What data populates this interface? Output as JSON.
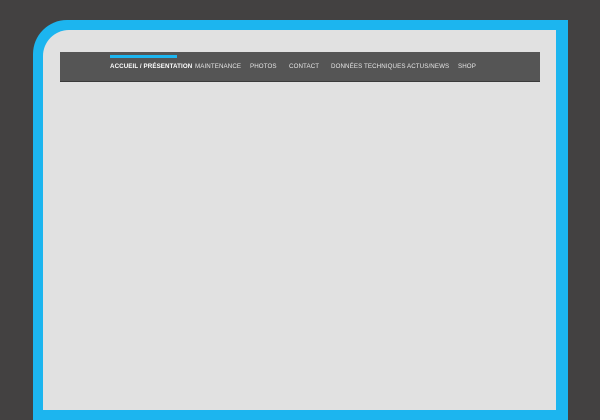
{
  "nav": {
    "items": [
      {
        "label": "ACCUEIL / PRÉSENTATION",
        "active": true
      },
      {
        "label": "MAINTENANCE",
        "active": false
      },
      {
        "label": "PHOTOS",
        "active": false
      },
      {
        "label": "CONTACT",
        "active": false
      },
      {
        "label": "DONNÉES TECHNIQUES",
        "active": false
      },
      {
        "label": "ACTUS/NEWS",
        "active": false
      },
      {
        "label": "SHOP",
        "active": false
      }
    ]
  },
  "colors": {
    "page_background": "#434141",
    "accent": "#1cb5ef",
    "content_background": "#e1e1e1",
    "navbar_background": "#555555"
  }
}
